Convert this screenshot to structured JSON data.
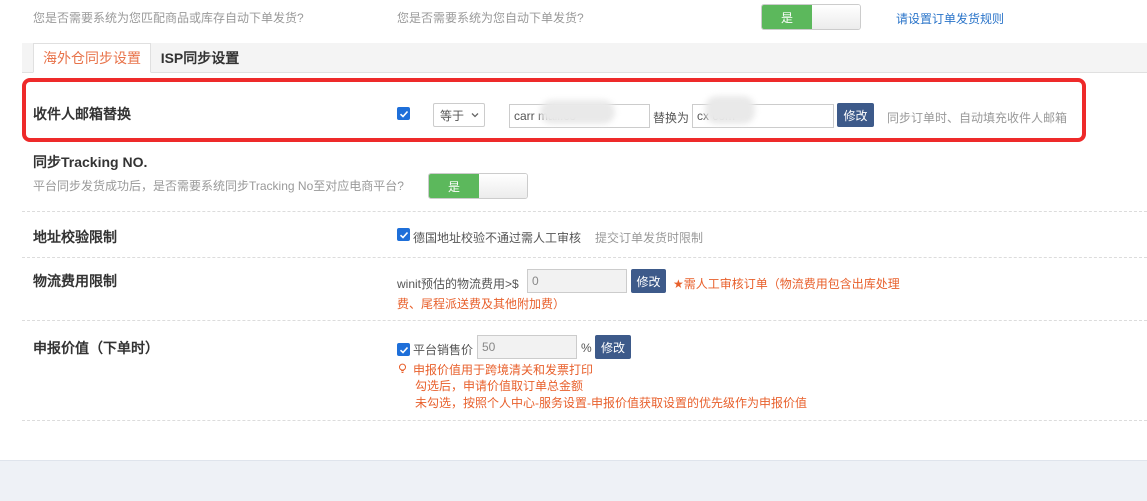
{
  "top_row": {
    "left_question": "您是否需要系统为您匹配商品或库存自动下单发货?",
    "mid_question": "您是否需要系统为您自动下单发货?",
    "toggle_label": "是",
    "rule_link": "请设置订单发货规则"
  },
  "tabs": [
    {
      "label": "海外仓同步设置",
      "active": true
    },
    {
      "label": "ISP同步设置",
      "active": false
    }
  ],
  "email_replace": {
    "title": "收件人邮箱替换",
    "operator": "等于",
    "from_value": "carr                        mail.co",
    "replace_label": "替换为",
    "to_value": "cx                  com",
    "modify_button": "修改",
    "hint": "同步订单时、自动填充收件人邮箱"
  },
  "tracking": {
    "title": "同步Tracking NO.",
    "question": "平台同步发货成功后，是否需要系统同步Tracking No至对应电商平台?",
    "toggle_label": "是"
  },
  "address_check": {
    "title": "地址校验限制",
    "checkbox_label": "德国地址校验不通过需人工审核",
    "note": "提交订单发货时限制"
  },
  "logistics_fee": {
    "title": "物流费用限制",
    "prefix": "winit预估的物流费用>$",
    "value": "0",
    "modify_button": "修改",
    "warning_line1": "需人工审核订单（物流费用包含出库处理",
    "warning_line2": "费、尾程派送费及其他附加费）"
  },
  "declared_value": {
    "title": "申报价值（下单时）",
    "checkbox_label": "平台销售价",
    "value": "50",
    "unit": "%",
    "modify_button": "修改",
    "tip_line1": "申报价值用于跨境清关和发票打印",
    "tip_line2": "勾选后，申请价值取订单总金额",
    "tip_line3": "未勾选，按照个人中心-服务设置-申报价值获取设置的优先级作为申报价值"
  },
  "colors": {
    "toggle_on": "#5cb85c",
    "accent_orange": "#e8602c",
    "button": "#3d5a8a",
    "link": "#2a74c9",
    "highlight_red": "#ee2a2a"
  }
}
